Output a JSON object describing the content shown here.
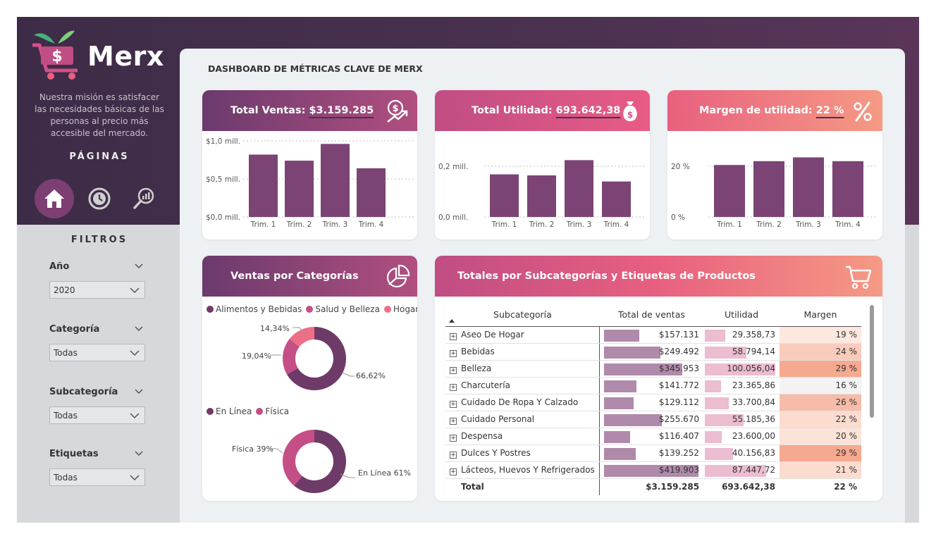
{
  "brand": {
    "name": "Merx",
    "mission": "Nuestra misión es satisfacer las necesidades básicas de las personas al precio más accesible del mercado."
  },
  "nav": {
    "pages_label": "PÁGINAS"
  },
  "filters": {
    "label": "FILTROS",
    "items": [
      {
        "title": "Año",
        "value": "2020"
      },
      {
        "title": "Categoría",
        "value": "Todas"
      },
      {
        "title": "Subcategoría",
        "value": "Todas"
      },
      {
        "title": "Etiquetas",
        "value": "Todas"
      }
    ]
  },
  "dashboard": {
    "title": "DASHBOARD DE MÉTRICAS CLAVE DE MERX"
  },
  "kpis": {
    "ventas": {
      "label": "Total Ventas: ",
      "value": "$3.159.285"
    },
    "utilidad": {
      "label": "Total Utilidad: ",
      "value": "693.642,38"
    },
    "margen": {
      "label": "Margen de utilidad: ",
      "value": "22 %"
    }
  },
  "colors": {
    "bar": "#7b4474",
    "grape": "#6e3a68",
    "pink": "#c44f86",
    "coral": "#ec6f86"
  },
  "chart_data": [
    {
      "type": "bar",
      "id": "ventas",
      "categories": [
        "Trim. 1",
        "Trim. 2",
        "Trim. 3",
        "Trim. 4"
      ],
      "values": [
        0.82,
        0.74,
        0.96,
        0.64
      ],
      "ylim": [
        0,
        1.0
      ],
      "ticks": [
        {
          "v": 0,
          "label": "$0,0 mill."
        },
        {
          "v": 0.5,
          "label": "$0,5 mill."
        },
        {
          "v": 1.0,
          "label": "$1,0 mill."
        }
      ]
    },
    {
      "type": "bar",
      "id": "utilidad",
      "categories": [
        "Trim. 1",
        "Trim. 2",
        "Trim. 3",
        "Trim. 4"
      ],
      "values": [
        0.168,
        0.164,
        0.224,
        0.14
      ],
      "ylim": [
        0,
        0.2
      ],
      "ticks": [
        {
          "v": 0,
          "label": "0,0 mill."
        },
        {
          "v": 0.2,
          "label": "0,2 mill."
        }
      ]
    },
    {
      "type": "bar",
      "id": "margen",
      "categories": [
        "Trim. 1",
        "Trim. 2",
        "Trim. 3",
        "Trim. 4"
      ],
      "values": [
        20.5,
        22,
        23.5,
        22
      ],
      "ylim": [
        0,
        20
      ],
      "ticks": [
        {
          "v": 0,
          "label": "0 %"
        },
        {
          "v": 20,
          "label": "20 %"
        }
      ]
    },
    {
      "type": "pie",
      "id": "categorias",
      "title": "Ventas por Categorías",
      "slices": [
        {
          "name": "Alimentos y Bebidas",
          "value": 66.62,
          "label": "66,62%",
          "color": "#6e3a68"
        },
        {
          "name": "Salud y Belleza",
          "value": 19.04,
          "label": "19,04%",
          "color": "#c44f86"
        },
        {
          "name": "Hogar",
          "value": 14.34,
          "label": "14,34%",
          "color": "#ec6f86"
        }
      ]
    },
    {
      "type": "pie",
      "id": "canal",
      "slices": [
        {
          "name": "En Línea",
          "value": 61,
          "label": "En Línea 61%",
          "color": "#6e3a68"
        },
        {
          "name": "Física",
          "value": 39,
          "label": "Física 39%",
          "color": "#c44f86"
        }
      ]
    },
    {
      "type": "table",
      "id": "subcategorias",
      "title": "Totales por Subcategorías y Etiquetas de Productos",
      "columns": [
        "Subcategoría",
        "Total de ventas",
        "Utilidad",
        "Margen"
      ],
      "rows": [
        {
          "sub": "Aseo De Hogar",
          "ventas_n": 157131,
          "ventas": "$157.131",
          "util_n": 29358.73,
          "util": "29.358,73",
          "margen_n": 19,
          "margen": "19 %"
        },
        {
          "sub": "Bebidas",
          "ventas_n": 249492,
          "ventas": "$249.492",
          "util_n": 58794.14,
          "util": "58.794,14",
          "margen_n": 24,
          "margen": "24 %"
        },
        {
          "sub": "Belleza",
          "ventas_n": 345953,
          "ventas": "$345.953",
          "util_n": 100056.04,
          "util": "100.056,04",
          "margen_n": 29,
          "margen": "29 %"
        },
        {
          "sub": "Charcutería",
          "ventas_n": 141772,
          "ventas": "$141.772",
          "util_n": 23365.86,
          "util": "23.365,86",
          "margen_n": 16,
          "margen": "16 %"
        },
        {
          "sub": "Cuidado De Ropa Y Calzado",
          "ventas_n": 129112,
          "ventas": "$129.112",
          "util_n": 33700.84,
          "util": "33.700,84",
          "margen_n": 26,
          "margen": "26 %"
        },
        {
          "sub": "Cuidado Personal",
          "ventas_n": 255670,
          "ventas": "$255.670",
          "util_n": 55185.36,
          "util": "55.185,36",
          "margen_n": 22,
          "margen": "22 %"
        },
        {
          "sub": "Despensa",
          "ventas_n": 116407,
          "ventas": "$116.407",
          "util_n": 23600.0,
          "util": "23.600,00",
          "margen_n": 20,
          "margen": "20 %"
        },
        {
          "sub": "Dulces Y Postres",
          "ventas_n": 139252,
          "ventas": "$139.252",
          "util_n": 40156.83,
          "util": "40.156,83",
          "margen_n": 29,
          "margen": "29 %"
        },
        {
          "sub": "Lácteos, Huevos Y Refrigerados",
          "ventas_n": 419903,
          "ventas": "$419.903",
          "util_n": 87447.72,
          "util": "87.447,72",
          "margen_n": 21,
          "margen": "21 %"
        }
      ],
      "total": {
        "label": "Total",
        "ventas": "$3.159.285",
        "util": "693.642,38",
        "margen": "22 %"
      }
    }
  ]
}
